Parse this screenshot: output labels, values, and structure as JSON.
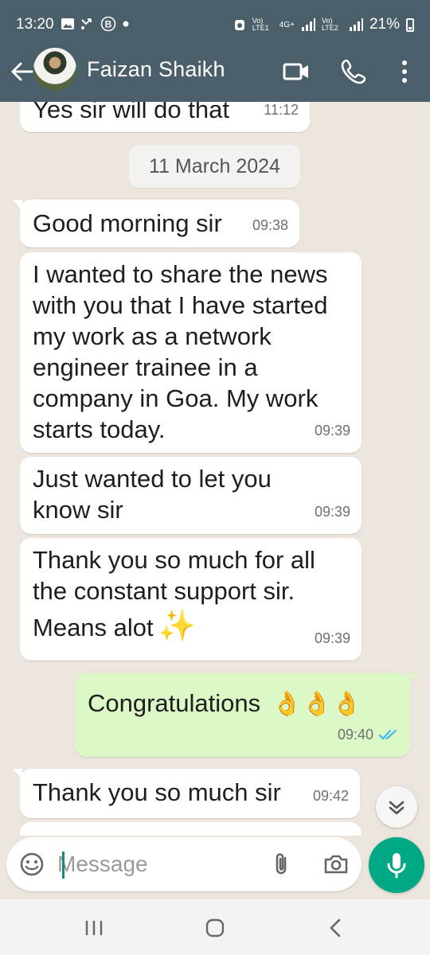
{
  "status_bar": {
    "time": "13:20",
    "network_1": "Vo) LTE1",
    "network_type": "4G+",
    "network_2": "Vo) LTE2",
    "battery": "21%"
  },
  "header": {
    "contact_name": "Faizan Shaikh"
  },
  "messages": [
    {
      "direction": "in",
      "text": "Yes sir will do that",
      "time": "11:12"
    },
    {
      "type": "date",
      "text": "11 March 2024"
    },
    {
      "direction": "in",
      "text": "Good morning sir",
      "time": "09:38"
    },
    {
      "direction": "in",
      "text": "I wanted to share the news with you that I have started my work as a network engineer trainee in a company in Goa. My work starts today.",
      "time": "09:39"
    },
    {
      "direction": "in",
      "text": "Just wanted to let you know sir",
      "time": "09:39"
    },
    {
      "direction": "in",
      "text": "Thank you so much for all the constant support sir.",
      "text2": "Means alot",
      "emoji": "✨",
      "time": "09:39"
    },
    {
      "direction": "out",
      "text": "Congratulations",
      "emoji": "👌👌👌",
      "time": "09:40",
      "status": "read"
    },
    {
      "direction": "in",
      "text": "Thank you so much sir",
      "time": "09:42"
    }
  ],
  "composer": {
    "placeholder": "Message"
  },
  "colors": {
    "header": "#4a5f69",
    "chat_bg": "#ece5dd",
    "outgoing_bubble": "#dcf8c6",
    "accent": "#00a884",
    "read_ticks": "#34b7f1"
  }
}
